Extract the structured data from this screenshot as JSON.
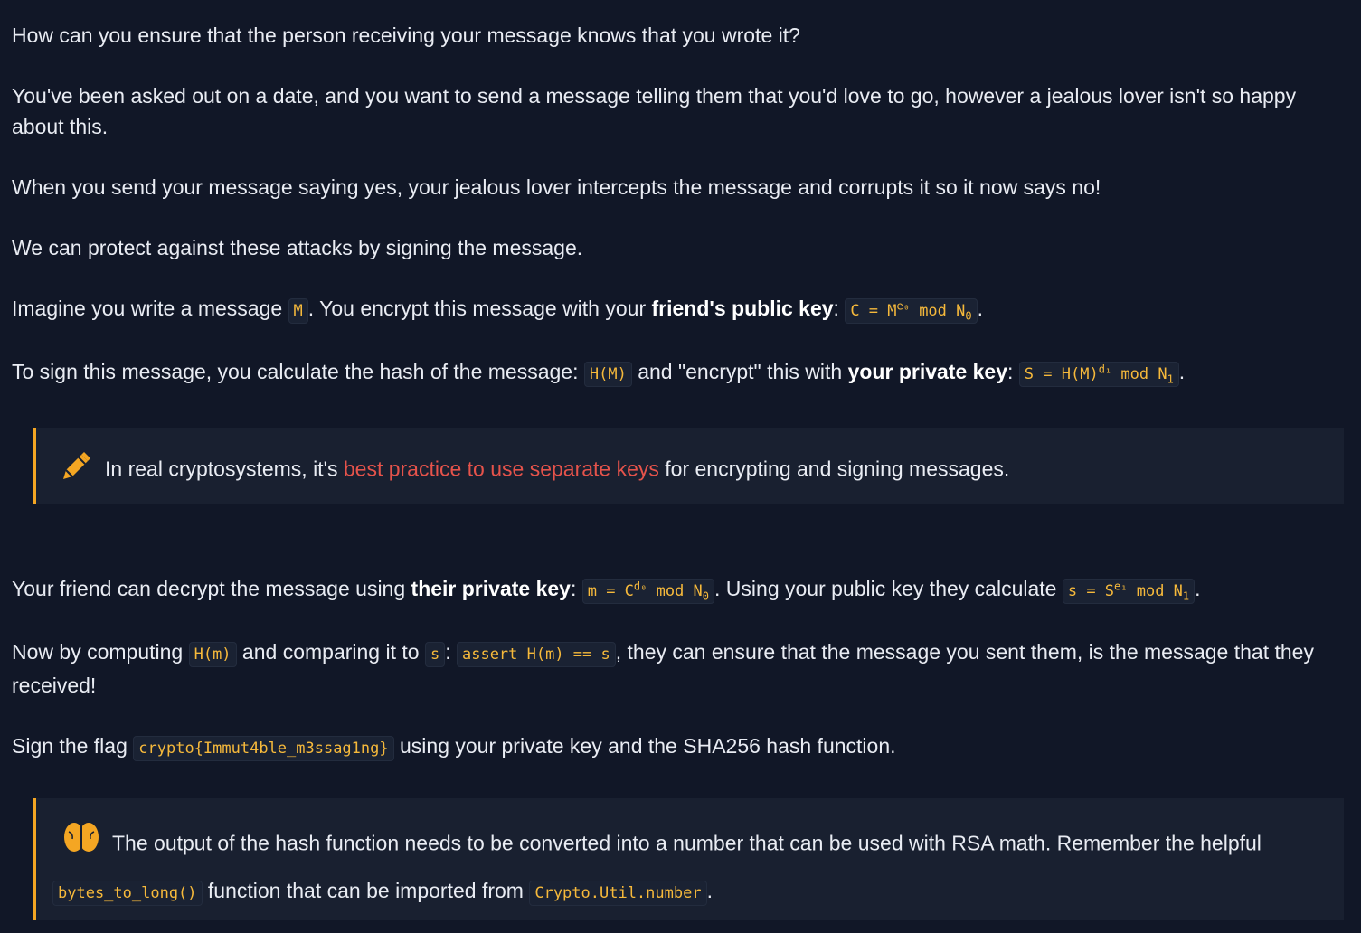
{
  "p1": "How can you ensure that the person receiving your message knows that you wrote it?",
  "p2": "You've been asked out on a date, and you want to send a message telling them that you'd love to go, however a jealous lover isn't so happy about this.",
  "p3": "When you send your message saying yes, your jealous lover intercepts the message and corrupts it so it now says no!",
  "p4": "We can protect against these attacks by signing the message.",
  "p5": {
    "t1": "Imagine you write a message ",
    "code1": "M",
    "t2": ". You encrypt this message with your ",
    "bold": "friend's public key",
    "t3": ": ",
    "code2_a": "C = M",
    "code2_sup": "e₀",
    "code2_b": " mod N",
    "code2_sub": "0",
    "t4": "."
  },
  "p6": {
    "t1": "To sign this message, you calculate the hash of the message: ",
    "code1": "H(M)",
    "t2": " and \"encrypt\" this with ",
    "bold": "your private key",
    "t3": ": ",
    "code2_a": "S = H(M)",
    "code2_sup": "d₁",
    "code2_b": " mod N",
    "code2_sub": "1",
    "t4": "."
  },
  "callout1": {
    "icon": "pencil-icon",
    "t1": "In real cryptosystems, it's ",
    "link": "best practice to use separate keys",
    "t2": " for encrypting and signing messages."
  },
  "p7": {
    "t1": "Your friend can decrypt the message using ",
    "bold": "their private key",
    "t2": ": ",
    "code1_a": "m = C",
    "code1_sup": "d₀",
    "code1_b": " mod N",
    "code1_sub": "0",
    "t3": ". Using your public key they calculate ",
    "code2_a": "s = S",
    "code2_sup": "e₁",
    "code2_b": " mod N",
    "code2_sub": "1",
    "t4": "."
  },
  "p8": {
    "t1": "Now by computing ",
    "code1": "H(m)",
    "t2": " and comparing it to ",
    "code2": "s",
    "t3": ": ",
    "code3": "assert H(m) == s",
    "t4": ", they can ensure that the message you sent them, is the message that they received!"
  },
  "p9": {
    "t1": "Sign the flag ",
    "code1": "crypto{Immut4ble_m3ssag1ng}",
    "t2": " using your private key and the SHA256 hash function."
  },
  "callout2": {
    "icon": "brain-icon",
    "t1": "The output of the hash function needs to be converted into a number that can be used with RSA math. Remember the helpful ",
    "code1": "bytes_to_long()",
    "t2": " function that can be imported from ",
    "code2": "Crypto.Util.number",
    "t3": "."
  },
  "colors": {
    "background": "#111727",
    "callout_bg": "#192030",
    "accent": "#f4a623",
    "code_text": "#f6b93b",
    "link": "#e5534b"
  }
}
